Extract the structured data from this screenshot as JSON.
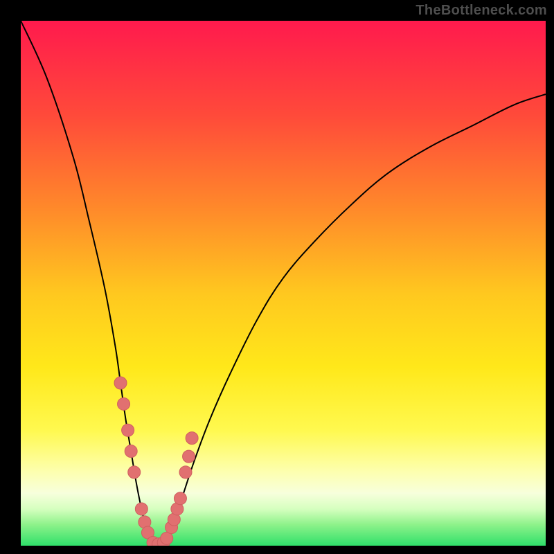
{
  "watermark": {
    "text": "TheBottleneck.com"
  },
  "colors": {
    "background": "#000000",
    "curve_stroke": "#000000",
    "marker_fill": "#e17070",
    "marker_stroke": "#cf5f5f"
  },
  "chart_data": {
    "type": "line",
    "title": "",
    "xlabel": "",
    "ylabel": "",
    "xlim": [
      0,
      100
    ],
    "ylim": [
      0,
      100
    ],
    "grid": false,
    "series": [
      {
        "name": "bottleneck-curve-left",
        "x": [
          0,
          5,
          10,
          13,
          16,
          18,
          19,
          20,
          21,
          22,
          23,
          24,
          25,
          26
        ],
        "values": [
          100,
          89,
          74,
          62,
          49,
          38,
          31,
          24,
          18,
          12,
          7,
          3,
          1,
          0
        ]
      },
      {
        "name": "bottleneck-curve-right",
        "x": [
          26,
          28,
          30,
          33,
          36,
          40,
          45,
          50,
          56,
          63,
          70,
          78,
          86,
          94,
          100
        ],
        "values": [
          0,
          2,
          7,
          16,
          24,
          33,
          43,
          51,
          58,
          65,
          71,
          76,
          80,
          84,
          86
        ]
      }
    ],
    "markers": {
      "name": "highlighted-points",
      "x": [
        19.0,
        19.6,
        20.4,
        21.0,
        21.6,
        23.0,
        23.6,
        24.2,
        25.2,
        26.2,
        27.2,
        27.8,
        28.7,
        29.2,
        29.8,
        30.4,
        31.4,
        32.0,
        32.6
      ],
      "values": [
        31.0,
        27.0,
        22.0,
        18.0,
        14.0,
        7.0,
        4.5,
        2.5,
        0.6,
        0.3,
        0.6,
        1.4,
        3.5,
        5.0,
        7.0,
        9.0,
        14.0,
        17.0,
        20.5
      ],
      "radius": 9
    }
  }
}
